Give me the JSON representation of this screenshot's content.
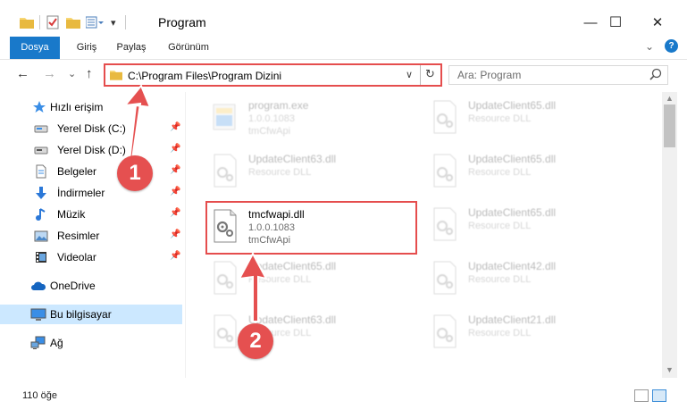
{
  "window": {
    "title": "Program",
    "controls": {
      "minimize": "—",
      "maximize": "☐",
      "close": "✕"
    }
  },
  "ribbon": {
    "tabs": [
      "Dosya",
      "Giriş",
      "Paylaş",
      "Görünüm"
    ],
    "help": "?",
    "collapse": "⌄"
  },
  "address_bar": {
    "path": "C:\\Program Files\\Program Dizini",
    "dropdown": "∨",
    "refresh": "↻"
  },
  "search": {
    "placeholder": "Ara: Program",
    "icon": "search-icon"
  },
  "nav_buttons": {
    "back": "←",
    "forward": "→",
    "recent": "⌄",
    "up": "↑"
  },
  "sidebar": {
    "quick_access": "Hızlı erişim",
    "items": [
      {
        "label": "Yerel Disk (C:)",
        "icon": "drive-icon",
        "pinned": true
      },
      {
        "label": "Yerel Disk (D:)",
        "icon": "drive-icon",
        "pinned": true
      },
      {
        "label": "Belgeler",
        "icon": "documents-icon",
        "pinned": true
      },
      {
        "label": "İndirmeler",
        "icon": "downloads-icon",
        "pinned": true
      },
      {
        "label": "Müzik",
        "icon": "music-icon",
        "pinned": true
      },
      {
        "label": "Resimler",
        "icon": "pictures-icon",
        "pinned": true
      },
      {
        "label": "Videolar",
        "icon": "videos-icon",
        "pinned": true
      }
    ],
    "onedrive": "OneDrive",
    "this_pc": "Bu bilgisayar",
    "network": "Ağ",
    "pin_glyph": "📌"
  },
  "files": [
    {
      "name": "program.exe",
      "line2": "1.0.0.1083",
      "line3": "tmCfwApi",
      "icon": "exe-icon",
      "highlighted": false
    },
    {
      "name": "UpdateClient65.dll",
      "line2": "Resource DLL",
      "line3": "",
      "icon": "dll-icon",
      "highlighted": false
    },
    {
      "name": "UpdateClient63.dll",
      "line2": "Resource DLL",
      "line3": "",
      "icon": "dll-icon",
      "highlighted": false
    },
    {
      "name": "UpdateClient65.dll",
      "line2": "Resource DLL",
      "line3": "",
      "icon": "dll-icon",
      "highlighted": false
    },
    {
      "name": "tmcfwapi.dll",
      "line2": "1.0.0.1083",
      "line3": "tmCfwApi",
      "icon": "dll-icon",
      "highlighted": true
    },
    {
      "name": "UpdateClient65.dll",
      "line2": "Resource DLL",
      "line3": "",
      "icon": "dll-icon",
      "highlighted": false
    },
    {
      "name": "UpdateClient65.dll",
      "line2": "Resource DLL",
      "line3": "",
      "icon": "dll-icon",
      "highlighted": false
    },
    {
      "name": "UpdateClient42.dll",
      "line2": "Resource DLL",
      "line3": "",
      "icon": "dll-icon",
      "highlighted": false
    },
    {
      "name": "UpdateClient63.dll",
      "line2": "Resource DLL",
      "line3": "",
      "icon": "dll-icon",
      "highlighted": false
    },
    {
      "name": "UpdateClient21.dll",
      "line2": "Resource DLL",
      "line3": "",
      "icon": "dll-icon",
      "highlighted": false
    }
  ],
  "status": {
    "count": "110 öğe"
  },
  "callouts": [
    "1",
    "2"
  ],
  "colors": {
    "accent": "#1979ca",
    "highlight": "#e54d4d",
    "selected_nav": "#cce8ff"
  }
}
